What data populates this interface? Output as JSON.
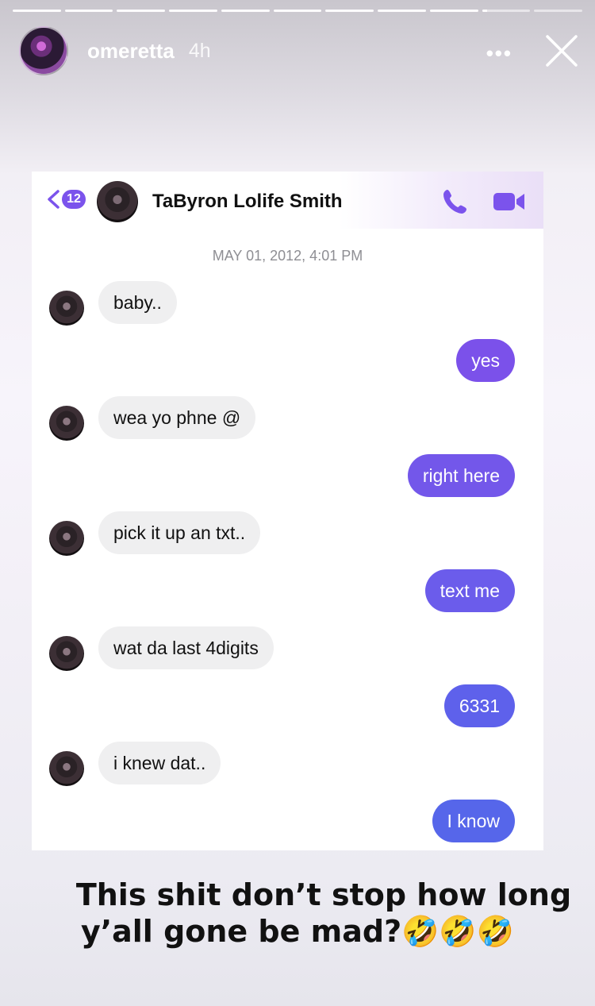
{
  "story": {
    "username": "omeretta",
    "time_ago": "4h",
    "more_label": "•••",
    "progress_total": 11,
    "progress_current_index": 9,
    "progress_current_fraction": 0.1
  },
  "messenger": {
    "back_badge": "12",
    "contact_name": "TaByron Lolife Smith",
    "timestamp": "MAY 01, 2012, 4:01 PM",
    "messages": [
      {
        "dir": "in",
        "text": "baby.."
      },
      {
        "dir": "out",
        "text": "yes",
        "color": "#7b51ea"
      },
      {
        "dir": "in",
        "text": "wea yo phne @"
      },
      {
        "dir": "out",
        "text": "right here",
        "color": "#7357ea"
      },
      {
        "dir": "in",
        "text": "pick it up an txt.."
      },
      {
        "dir": "out",
        "text": "text me",
        "color": "#6b5ceb"
      },
      {
        "dir": "in",
        "text": "wat da last 4digits"
      },
      {
        "dir": "out",
        "text": "6331",
        "color": "#5e61eb"
      },
      {
        "dir": "in",
        "text": "i knew dat.."
      },
      {
        "dir": "out",
        "text": "I know",
        "color": "#5666ea"
      }
    ]
  },
  "caption": {
    "line1": "This shit don’t stop how long",
    "line2": "y’all gone be mad?🤣🤣🤣"
  },
  "colors": {
    "accent": "#7b53ec",
    "incoming_bubble": "#efeff0",
    "timestamp": "#8e8e93"
  },
  "icons": {
    "back": "chevron-left-icon",
    "call": "phone-icon",
    "video": "video-camera-icon",
    "close": "close-icon",
    "more": "more-horizontal-icon"
  }
}
